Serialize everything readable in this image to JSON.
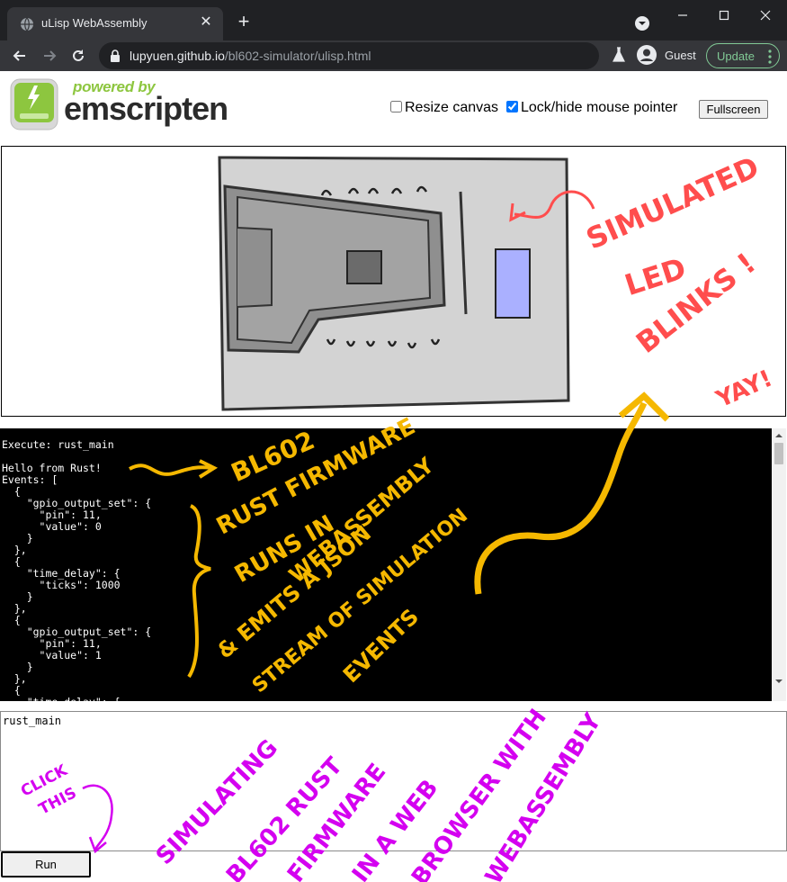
{
  "browser": {
    "tab_title": "uLisp WebAssembly",
    "url_host": "lupyuen.github.io",
    "url_path": "/bl602-simulator/ulisp.html",
    "profile": "Guest",
    "update_label": "Update"
  },
  "header": {
    "powered_by": "powered by",
    "brand": "emscripten",
    "resize_canvas": "Resize canvas",
    "lock_pointer": "Lock/hide mouse pointer",
    "fullscreen": "Fullscreen"
  },
  "console": {
    "lines": "Execute: rust_main\n\nHello from Rust!\nEvents: [\n  {\n    \"gpio_output_set\": {\n      \"pin\": 11,\n      \"value\": 0\n    }\n  },\n  {\n    \"time_delay\": {\n      \"ticks\": 1000\n    }\n  },\n  {\n    \"gpio_output_set\": {\n      \"pin\": 11,\n      \"value\": 1\n    }\n  },\n  {\n    \"time_delay\": {"
  },
  "input": {
    "value": "rust_main",
    "run_label": "Run"
  },
  "annotations": {
    "led_1": "SIMULATED",
    "led_2": "LED",
    "led_3": "BLINKS !",
    "yay": "YAY!",
    "fw_1": "BL602",
    "fw_2": "RUST FIRMWARE",
    "fw_3": "RUNS IN",
    "fw_4": "WEBASSEMBLY",
    "ev_1": "& EMITS A JSON",
    "ev_2": "STREAM OF SIMULATION",
    "ev_3": "EVENTS",
    "click_1": "CLICK",
    "click_2": "THIS",
    "main_1": "SIMULATING",
    "main_2": "BL602 RUST",
    "main_3": "FIRMWARE",
    "main_4": "IN A WEB",
    "main_5": "BROWSER WITH",
    "main_6": "WEBASSEMBLY"
  },
  "colors": {
    "annotation_yellow": "#f5b800",
    "annotation_red": "#ff4d4d",
    "annotation_purple": "#d400f0",
    "led_blue": "#aab0ff"
  }
}
